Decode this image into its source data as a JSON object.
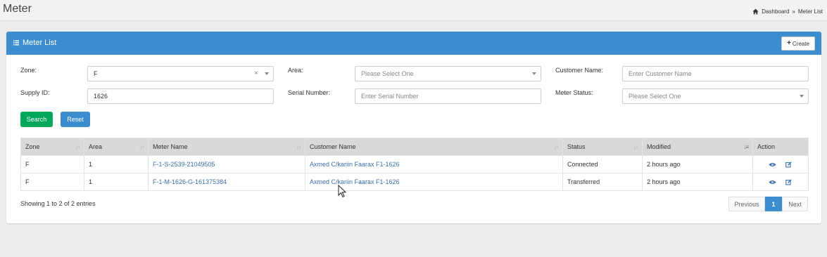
{
  "page": {
    "title": "Meter"
  },
  "breadcrumb": {
    "home": "Dashboard",
    "separator": "»",
    "current": "Meter List"
  },
  "panel": {
    "title": "Meter List",
    "create_label": "Create"
  },
  "filters": {
    "zone": {
      "label": "Zone:",
      "value": "F",
      "clear": "×"
    },
    "area": {
      "label": "Area:",
      "placeholder": "Please Select One"
    },
    "customer_name": {
      "label": "Customer Name:",
      "placeholder": "Enter Customer Name"
    },
    "supply_id": {
      "label": "Supply ID:",
      "value": "1626"
    },
    "serial_number": {
      "label": "Serial Number:",
      "placeholder": "Enter Serial Number"
    },
    "meter_status": {
      "label": "Meter Status:",
      "placeholder": "Please Select One"
    }
  },
  "buttons": {
    "search": "Search",
    "reset": "Reset"
  },
  "table": {
    "columns": [
      "Zone",
      "Area",
      "Meter Name",
      "Customer Name",
      "Status",
      "Modified",
      "Action"
    ],
    "rows": [
      {
        "zone": "F",
        "area": "1",
        "meter_name": "F-1-S-2539-21049505",
        "customer_name": "Axmed C/kariin Faarax F1-1626",
        "status": "Connected",
        "modified": "2 hours ago"
      },
      {
        "zone": "F",
        "area": "1",
        "meter_name": "F-1-M-1626-G-161375384",
        "customer_name": "Axmed C/kariin Faarax F1-1626",
        "status": "Transferred",
        "modified": "2 hours ago"
      }
    ]
  },
  "footer": {
    "info": "Showing 1 to 2 of 2 entries"
  },
  "pagination": {
    "previous": "Previous",
    "current": "1",
    "next": "Next"
  },
  "colors": {
    "primary": "#3c8dcf",
    "success": "#00a65a",
    "link": "#3c6ea8"
  }
}
